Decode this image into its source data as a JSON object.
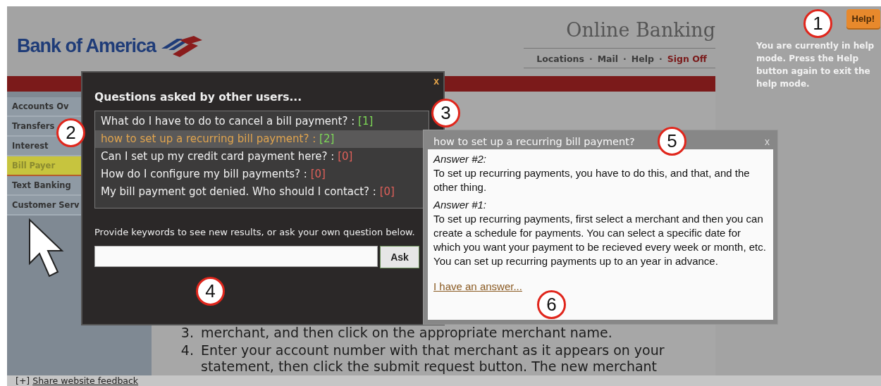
{
  "header": {
    "logo": "Bank of America",
    "title": "Online Banking",
    "separator": "·",
    "nav": [
      {
        "label": "Locations",
        "kind": "link"
      },
      {
        "label": "Mail",
        "kind": "link"
      },
      {
        "label": "Help",
        "kind": "link"
      },
      {
        "label": "Sign Off",
        "kind": "signoff"
      }
    ]
  },
  "sidebar": {
    "items": [
      {
        "label": "Accounts Ov",
        "selected": false
      },
      {
        "label": "Transfers",
        "selected": false
      },
      {
        "label": "Interest",
        "selected": false
      },
      {
        "label": "Bill Payer",
        "selected": true
      },
      {
        "label": "Text Banking",
        "selected": false
      },
      {
        "label": "Customer Serv",
        "selected": false
      }
    ]
  },
  "content": {
    "steps": [
      {
        "number": "3.",
        "text": "merchant, and then click on the appropriate merchant name."
      },
      {
        "number": "4.",
        "text": "Enter your account number with that merchant as it appears on your statement, then click the submit request button. The new merchant"
      }
    ]
  },
  "footer": {
    "toggle": "[+]",
    "label": "Share website feedback"
  },
  "help": {
    "button": "Help!",
    "message": "You are currently in help mode. Press the Help button again to exit the help mode."
  },
  "questions_dialog": {
    "close": "x",
    "title": "Questions asked by other users...",
    "questions": [
      {
        "text": "What do I have to do to cancel a bill payment? :",
        "count": "[1]",
        "color": "#7ed957",
        "selected": false
      },
      {
        "text": "how to set up a recurring bill payment? :",
        "count": "[2]",
        "color": "#7ed957",
        "selected": true
      },
      {
        "text": "Can I set up my credit card payment here? :",
        "count": "[0]",
        "color": "#e0605a",
        "selected": false
      },
      {
        "text": "How do I configure my bill payments? :",
        "count": "[0]",
        "color": "#e0605a",
        "selected": false
      },
      {
        "text": "My bill payment got denied. Who should I contact? :",
        "count": "[0]",
        "color": "#e0605a",
        "selected": false
      }
    ],
    "prompt": "Provide keywords to see new results, or ask your own question below.",
    "ask_button": "Ask"
  },
  "answer_dialog": {
    "title": "how to set up a recurring bill payment?",
    "close": "x",
    "answers": [
      {
        "label": "Answer #2:",
        "text": "To set up recurring payments, you have to do this, and that, and the other thing."
      },
      {
        "label": "Answer #1:",
        "text": "To set up recurring payments, first select a merchant and then you can create a schedule for payments. You can select a specific date for which you want your payment to be recieved every week or month, etc. You can set up recurring payments up to an year in advance."
      }
    ],
    "link": "I have an answer..."
  },
  "callouts": [
    "1",
    "2",
    "3",
    "4",
    "5",
    "6"
  ]
}
